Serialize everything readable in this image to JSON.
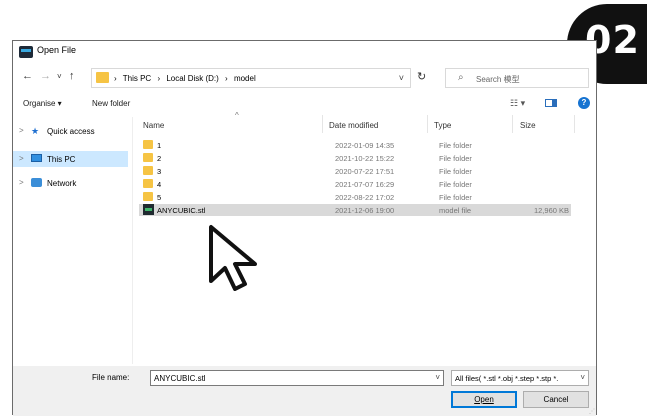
{
  "badge": {
    "text": "02"
  },
  "window": {
    "title": "Open File",
    "icon": "app-icon"
  },
  "nav": {
    "back": "←",
    "forward": "→",
    "recent": "˅",
    "up": "↑",
    "breadcrumb": [
      "This PC",
      "Local Disk (D:)",
      "model"
    ],
    "separator": "›",
    "dropdown": "˅",
    "refresh": "↻",
    "search_icon": "⌕",
    "search_placeholder": "Search 模型"
  },
  "toolbar": {
    "organise": "Organise ▾",
    "new_folder": "New folder",
    "views": "☷ ▾",
    "help": "?"
  },
  "sidebar": {
    "items": [
      {
        "label": "Quick access",
        "icon": "star-icon",
        "glyph": "★",
        "selected": false
      },
      {
        "label": "This PC",
        "icon": "computer-icon",
        "glyph": "",
        "selected": true
      },
      {
        "label": "Network",
        "icon": "network-icon",
        "glyph": "",
        "selected": false
      }
    ]
  },
  "columns": {
    "name": "Name",
    "date": "Date modified",
    "type": "Type",
    "size": "Size",
    "sort_glyph": "^"
  },
  "files": [
    {
      "name": "1",
      "date": "2022-01-09 14:35",
      "type": "File folder",
      "size": "",
      "kind": "folder"
    },
    {
      "name": "2",
      "date": "2021-10-22 15:22",
      "type": "File folder",
      "size": "",
      "kind": "folder"
    },
    {
      "name": "3",
      "date": "2020-07-22 17:51",
      "type": "File folder",
      "size": "",
      "kind": "folder"
    },
    {
      "name": "4",
      "date": "2021-07-07 16:29",
      "type": "File folder",
      "size": "",
      "kind": "folder"
    },
    {
      "name": "5",
      "date": "2022-08-22 17:02",
      "type": "File folder",
      "size": "",
      "kind": "folder"
    },
    {
      "name": "ANYCUBIC.stl",
      "date": "2021-12-06 19:00",
      "type": "model file",
      "size": "12,960 KB",
      "kind": "stl"
    }
  ],
  "footer": {
    "filename_label": "File name:",
    "filename_value": "ANYCUBIC.stl",
    "filter_value": "All files( *.stl *.obj *.step *.stp *.",
    "dropdown": "˅",
    "open_label": "Open",
    "cancel_label": "Cancel"
  },
  "colors": {
    "selection": "#cce8ff",
    "selected_row": "#d9d9d9",
    "folder": "#f6c444",
    "accent": "#0078d7"
  }
}
